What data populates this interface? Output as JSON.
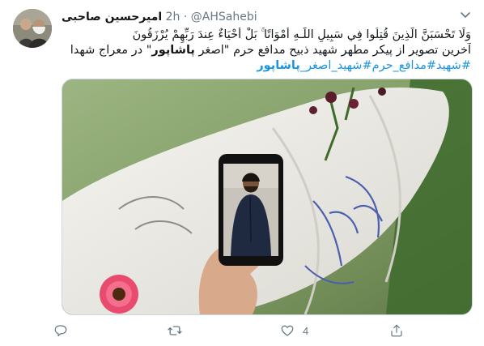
{
  "tweet": {
    "author_name": "امیرحسین صاحبی",
    "handle": "@AHSahebi",
    "separator": "·",
    "time": "2h",
    "text_line1": "وَلَا تَحْسَبَنَّ الَّذِينَ قُتِلُوا فِي سَبِيلِ اللَّـهِ أَمْوَاتًا ۚ بَلْ أَحْيَاءٌ عِندَ رَبِّهِمْ يُرْزَقُونَ",
    "text_line2_pre": "آخرین تصویر از پیکر مطهر شهید ذبیح مدافع حرم \"اصغر ",
    "text_line2_bold": "پاشاپور",
    "text_line2_post": "\" در معراج شهدا",
    "hashtags": [
      "#شهید",
      "#مدافع_حرم",
      "#شهید_اصغر_",
      "پاشاپور"
    ],
    "likes": "4",
    "retweets": "",
    "replies": ""
  },
  "icons": {
    "caret": "chevron-down-icon",
    "reply": "reply-icon",
    "retweet": "retweet-icon",
    "like": "heart-icon",
    "share": "share-icon"
  },
  "colors": {
    "link": "#1b95e0",
    "secondary": "#657786"
  }
}
